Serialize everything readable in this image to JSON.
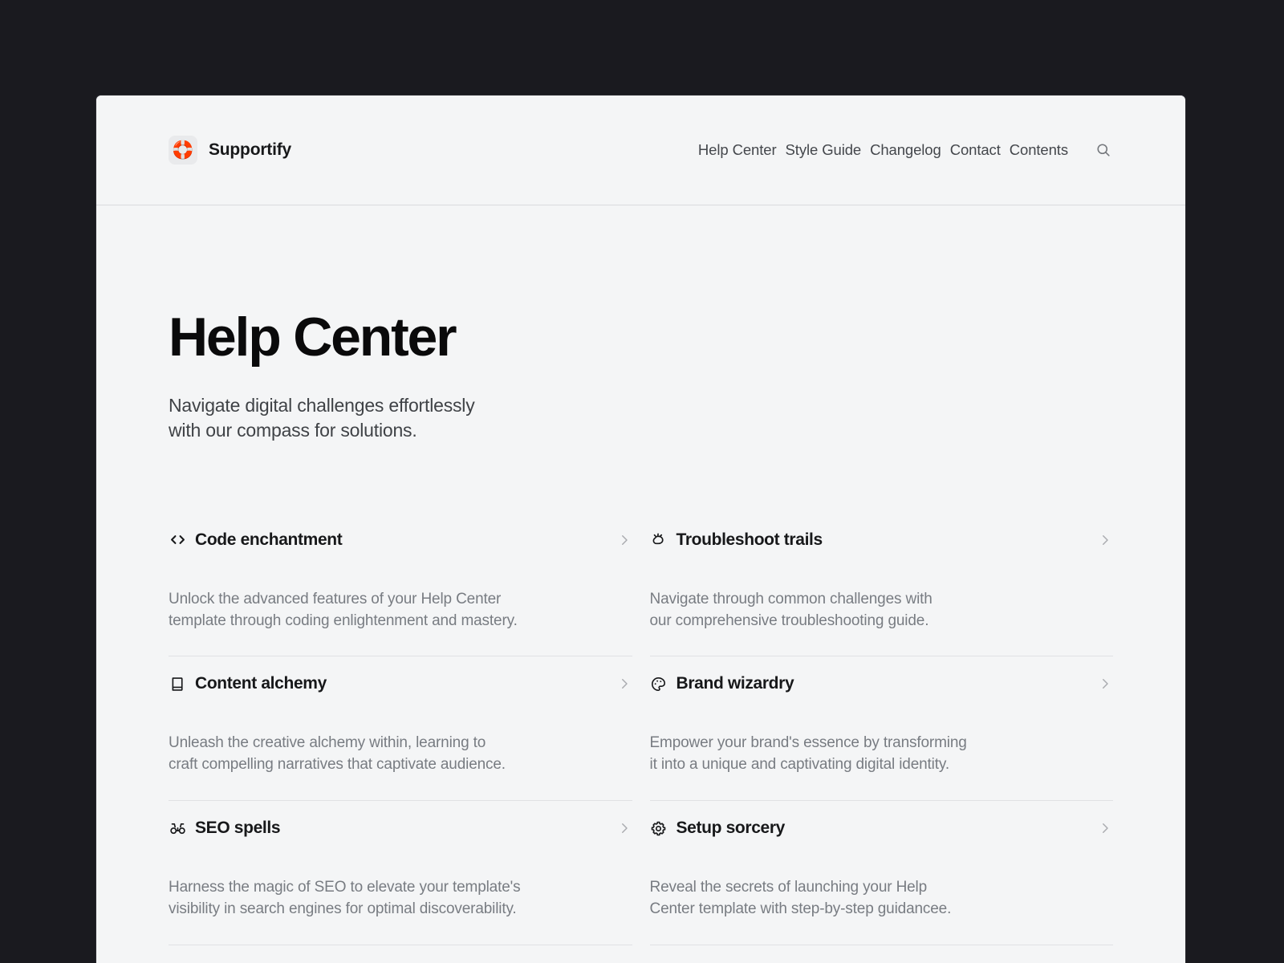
{
  "brand": {
    "icon": "lifebuoy-icon",
    "name": "Supportify"
  },
  "nav": {
    "items": [
      {
        "label": "Help Center"
      },
      {
        "label": "Style Guide"
      },
      {
        "label": "Changelog"
      },
      {
        "label": "Contact"
      },
      {
        "label": "Contents"
      }
    ],
    "search_icon": "search-icon"
  },
  "hero": {
    "title": "Help Center",
    "subtitle": "Navigate digital challenges effortlessly\nwith our  compass for solutions."
  },
  "topics": {
    "left": [
      {
        "icon": "code-icon",
        "title": "Code enchantment",
        "description": "Unlock the advanced features of your Help Center\ntemplate through coding enlightenment and mastery.",
        "chevron": "chevron-right-icon"
      },
      {
        "icon": "book-icon",
        "title": "Content alchemy",
        "description": "Unleash the creative alchemy within, learning to\ncraft compelling narratives that captivate audience.",
        "chevron": "chevron-right-icon"
      },
      {
        "icon": "binoculars-icon",
        "title": "SEO spells",
        "description": "Harness the magic of SEO to elevate your template's\nvisibility in search engines for optimal discoverability.",
        "chevron": "chevron-right-icon"
      }
    ],
    "right": [
      {
        "icon": "bug-icon",
        "title": "Troubleshoot trails",
        "description": "Navigate through common challenges with\nour comprehensive troubleshooting guide.",
        "chevron": "chevron-right-icon"
      },
      {
        "icon": "palette-icon",
        "title": "Brand wizardry",
        "description": "Empower your brand's essence by  transforming\nit into a unique and captivating digital identity.",
        "chevron": "chevron-right-icon"
      },
      {
        "icon": "gear-icon",
        "title": "Setup sorcery",
        "description": "Reveal the secrets of launching your Help\nCenter template with step-by-step guidancee.",
        "chevron": "chevron-right-icon"
      }
    ]
  },
  "colors": {
    "stage_background": "#1a1a1f",
    "page_background": "#f4f5f6",
    "text_primary": "#17181a",
    "text_secondary": "#787c82",
    "divider": "#e0e1e4",
    "chevron": "#a9abaf"
  }
}
